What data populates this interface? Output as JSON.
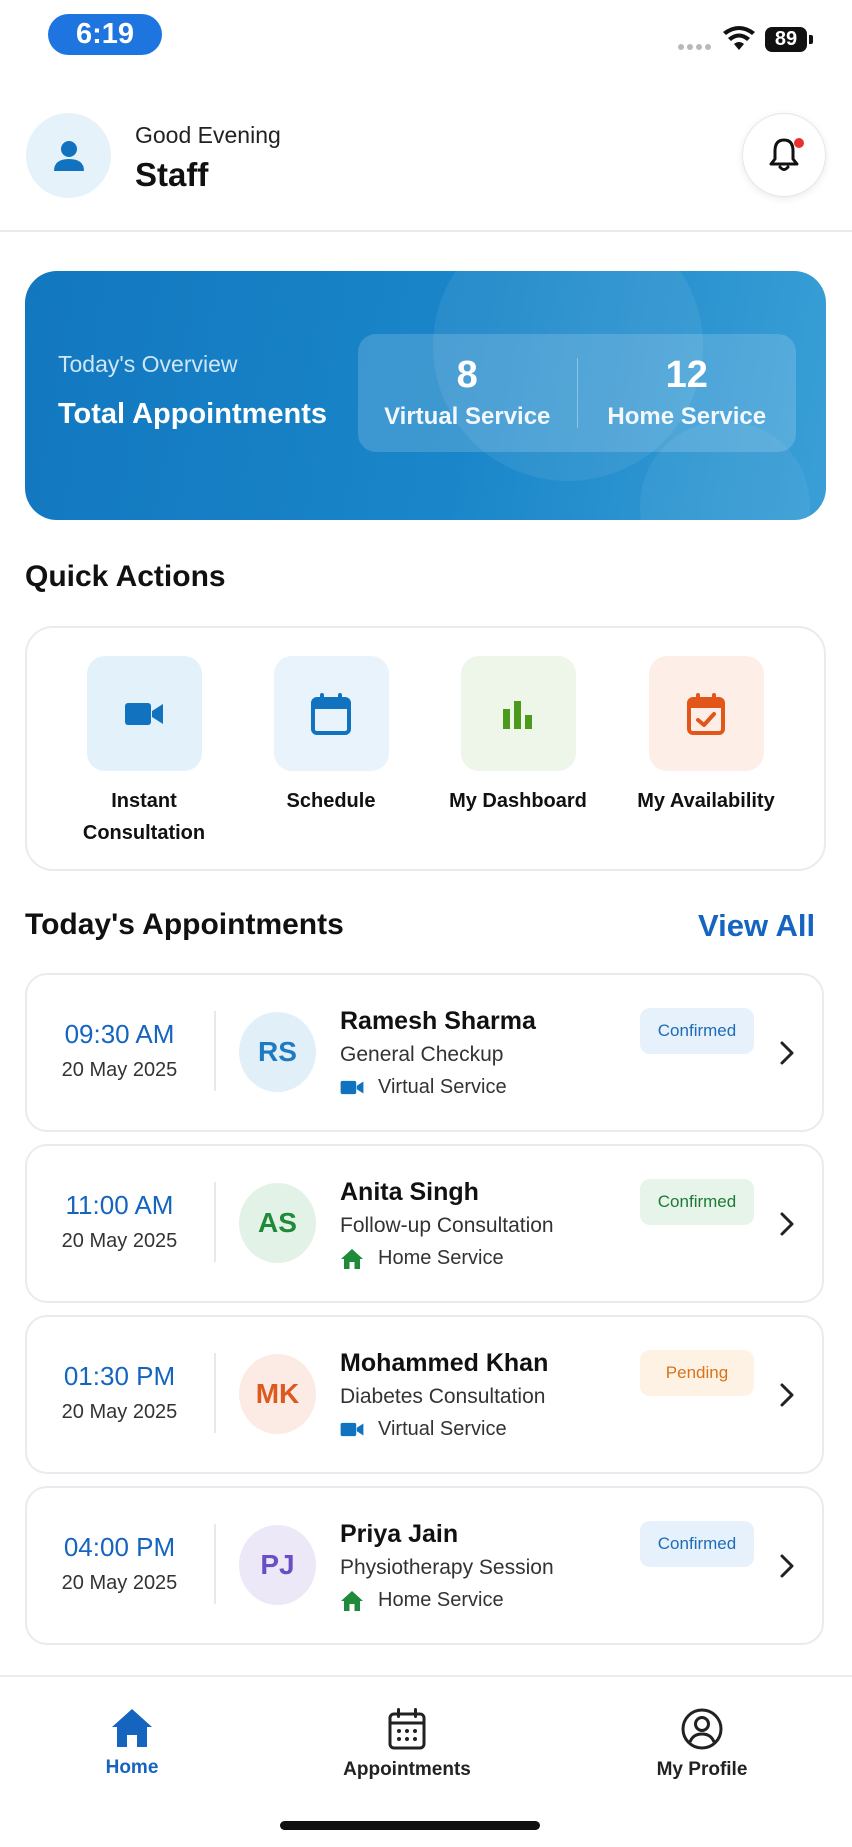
{
  "status_bar": {
    "time": "6:19",
    "battery": "89"
  },
  "header": {
    "greeting": "Good Evening",
    "user_name": "Staff"
  },
  "overview": {
    "caption": "Today's Overview",
    "title": "Total Appointments",
    "stats": [
      {
        "value": "8",
        "label": "Virtual Service"
      },
      {
        "value": "12",
        "label": "Home Service"
      }
    ]
  },
  "quick_actions": {
    "title": "Quick Actions",
    "items": [
      {
        "label_line1": "Instant",
        "label_line2": "Consultation",
        "icon": "video-icon",
        "tile_color": "#e3f1fb",
        "icon_color": "#1172c0"
      },
      {
        "label_line1": "Schedule",
        "label_line2": "",
        "icon": "calendar-icon",
        "tile_color": "#e8f3fb",
        "icon_color": "#1172c0"
      },
      {
        "label_line1": "My Dashboard",
        "label_line2": "",
        "icon": "bar-chart-icon",
        "tile_color": "#edf6e8",
        "icon_color": "#4c9a1c"
      },
      {
        "label_line1": "My Availability",
        "label_line2": "",
        "icon": "calendar-check-icon",
        "tile_color": "#fdefe8",
        "icon_color": "#e2561a"
      }
    ]
  },
  "appointments": {
    "title": "Today's Appointments",
    "view_all": "View All",
    "items": [
      {
        "time": "09:30 AM",
        "date": "20 May 2025",
        "initials": "RS",
        "name": "Ramesh Sharma",
        "type": "General Checkup",
        "service": "Virtual Service",
        "service_icon": "video-icon",
        "status": "Confirmed",
        "avatar_bg": "#e1eff9",
        "avatar_fg": "#1e7ac1",
        "badge_bg": "#e6f1fb",
        "badge_fg": "#1e6bb8"
      },
      {
        "time": "11:00 AM",
        "date": "20 May 2025",
        "initials": "AS",
        "name": "Anita Singh",
        "type": "Follow-up Consultation",
        "service": "Home Service",
        "service_icon": "home-icon",
        "status": "Confirmed",
        "avatar_bg": "#e3f2e6",
        "avatar_fg": "#1f8a3a",
        "badge_bg": "#e6f4e9",
        "badge_fg": "#1f7a36"
      },
      {
        "time": "01:30 PM",
        "date": "20 May 2025",
        "initials": "MK",
        "name": "Mohammed Khan",
        "type": "Diabetes Consultation",
        "service": "Virtual Service",
        "service_icon": "video-icon",
        "status": "Pending",
        "avatar_bg": "#fcebe4",
        "avatar_fg": "#dc5a1f",
        "badge_bg": "#fdf2e4",
        "badge_fg": "#d9731a"
      },
      {
        "time": "04:00 PM",
        "date": "20 May 2025",
        "initials": "PJ",
        "name": "Priya Jain",
        "type": "Physiotherapy Session",
        "service": "Home Service",
        "service_icon": "home-icon",
        "status": "Confirmed",
        "avatar_bg": "#ece8f8",
        "avatar_fg": "#6a4fc4",
        "badge_bg": "#e6f1fb",
        "badge_fg": "#1e6bb8"
      }
    ]
  },
  "bottom_nav": {
    "items": [
      {
        "label": "Home",
        "icon": "home-icon",
        "active": true
      },
      {
        "label": "Appointments",
        "icon": "calendar-grid-icon",
        "active": false
      },
      {
        "label": "My Profile",
        "icon": "user-circle-icon",
        "active": false
      }
    ]
  },
  "colors": {
    "primary": "#1565c0",
    "overview_gradient_start": "#1277bf",
    "overview_gradient_end": "#3a9fd6",
    "notification_dot": "#e8302f"
  }
}
